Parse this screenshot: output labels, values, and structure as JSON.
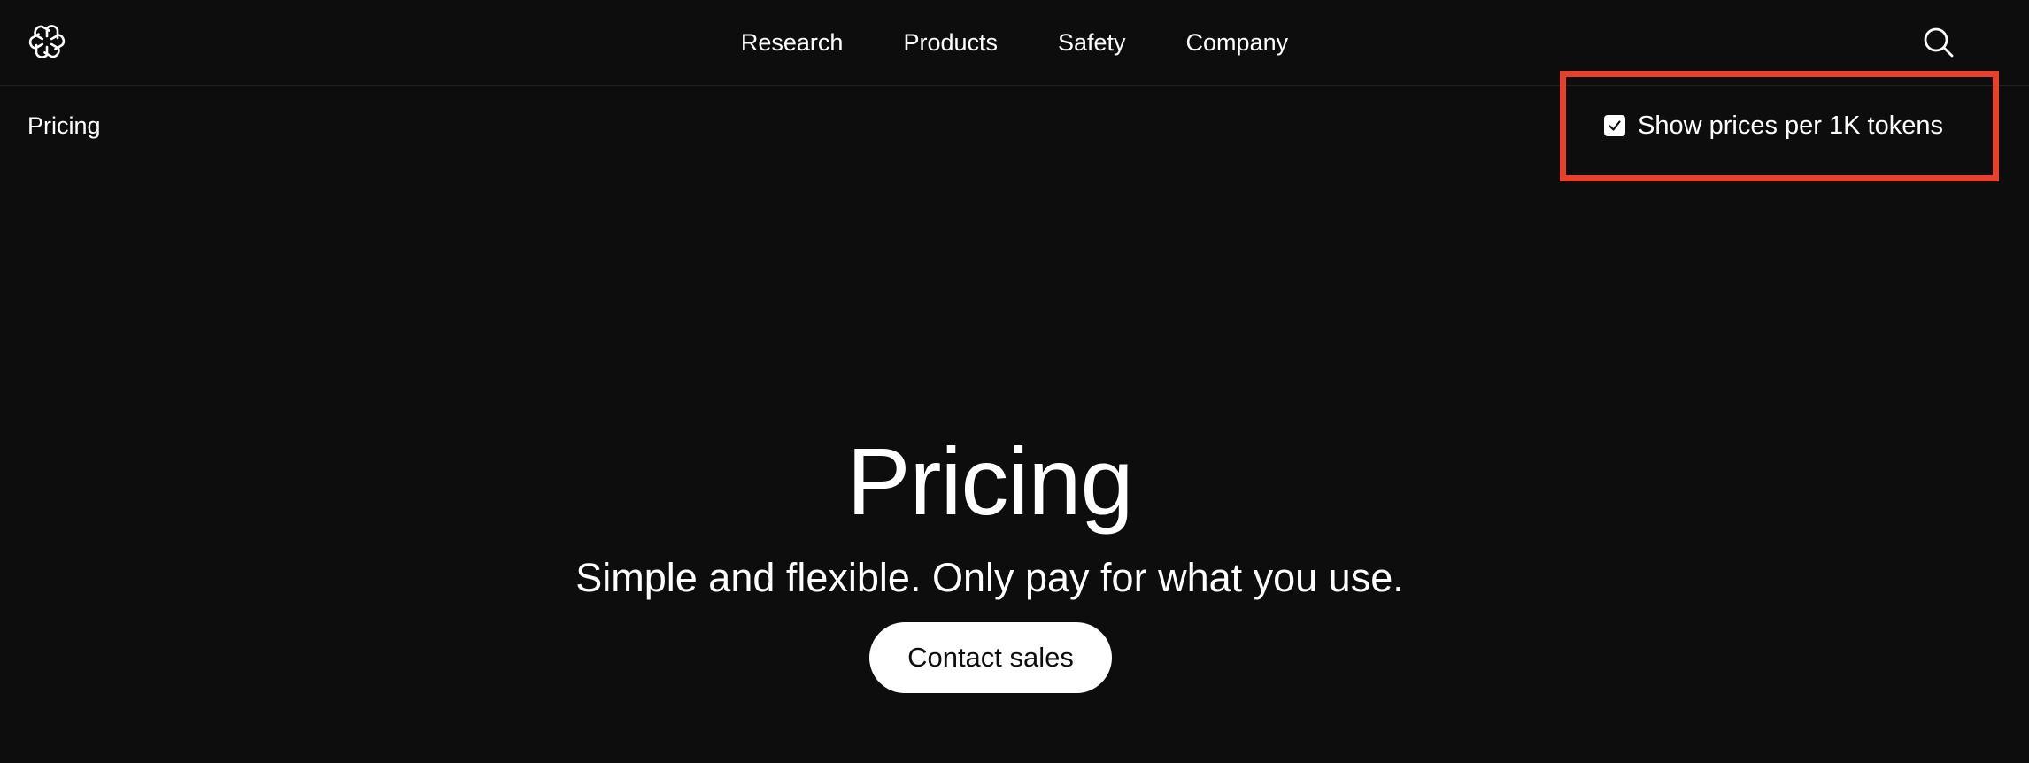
{
  "nav": {
    "logo_icon": "openai-logo-icon",
    "links": [
      "Research",
      "Products",
      "Safety",
      "Company"
    ],
    "search_icon": "search-icon"
  },
  "breadcrumb": {
    "label": "Pricing"
  },
  "price_toggle": {
    "label": "Show prices per 1K tokens",
    "checked": true,
    "highlight_color": "#e8412b"
  },
  "hero": {
    "title": "Pricing",
    "subtitle": "Simple and flexible. Only pay for what you use.",
    "cta_label": "Contact sales"
  },
  "colors": {
    "background": "#0d0d0d",
    "text": "#ffffff"
  }
}
